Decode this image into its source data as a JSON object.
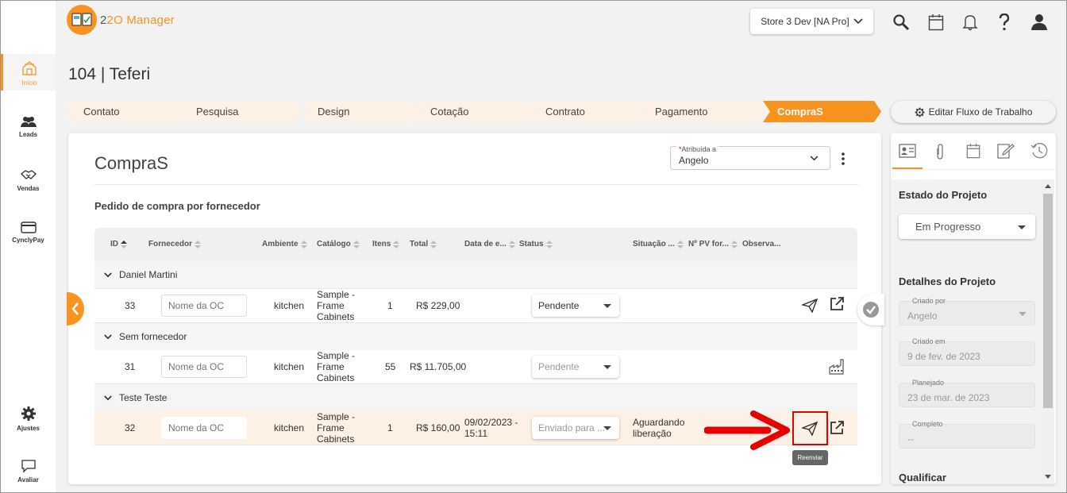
{
  "app": {
    "name_prefix": "2",
    "name_o": "O",
    "name_rest": "2O Manager",
    "brand_color": "#f7931e"
  },
  "nav": {
    "items": [
      {
        "label": "Início",
        "icon": "home-icon"
      },
      {
        "label": "Leads",
        "icon": "users-icon"
      },
      {
        "label": "Vendas",
        "icon": "handshake-icon"
      },
      {
        "label": "CynclyPay",
        "icon": "card-icon"
      },
      {
        "label": "Ajustes",
        "icon": "gear-icon"
      },
      {
        "label": "Avaliar",
        "icon": "chat-icon"
      }
    ]
  },
  "header": {
    "store": "Store 3 Dev [NA Pro]"
  },
  "page": {
    "title": "104 | Teferi"
  },
  "workflow": {
    "steps": [
      "Contato",
      "Pesquisa",
      "Design",
      "Cotação",
      "Contrato",
      "Pagamento",
      "CompraS"
    ],
    "active": "CompraS",
    "edit_label": "Editar Fluxo de Trabalho"
  },
  "main": {
    "title": "CompraS",
    "assigned_label": "Atribuída a",
    "assigned_value": "Angelo",
    "subtitle": "Pedido de compra por fornecedor",
    "columns": [
      "ID",
      "Fornecedor",
      "Ambiente",
      "Catálogo",
      "Itens",
      "Total",
      "Data de e...",
      "Status",
      "Situação ...",
      "Nº PV for...",
      "Observa..."
    ],
    "groups": [
      {
        "name": "Daniel Martini",
        "row": {
          "id": "33",
          "oc_placeholder": "Nome da OC",
          "ambiente": "kitchen",
          "catalog": [
            "Sample -",
            "Frame",
            "Cabinets"
          ],
          "itens": "1",
          "total": "R$ 229,00",
          "data_line1": "",
          "data_line2": "",
          "status": "Pendente",
          "situacao_line1": "",
          "situacao_line2": ""
        }
      },
      {
        "name": "Sem fornecedor",
        "row": {
          "id": "31",
          "oc_placeholder": "Nome da OC",
          "ambiente": "kitchen",
          "catalog": [
            "Sample -",
            "Frame",
            "Cabinets"
          ],
          "itens": "55",
          "total": "R$ 11.705,00",
          "data_line1": "",
          "data_line2": "",
          "status": "Pendente",
          "situacao_line1": "",
          "situacao_line2": ""
        }
      },
      {
        "name": "Teste Teste",
        "row": {
          "id": "32",
          "oc_placeholder": "Nome da OC",
          "ambiente": "kitchen",
          "catalog": [
            "Sample -",
            "Frame",
            "Cabinets"
          ],
          "itens": "1",
          "total": "R$ 160,00",
          "data_line1": "09/02/2023 -",
          "data_line2": "15:11",
          "status": "Enviado para ...",
          "situacao_line1": "Aguardando",
          "situacao_line2": "liberação"
        }
      }
    ],
    "tooltip": "Reenviar"
  },
  "right_panel": {
    "tabs": [
      "contact-card-icon",
      "paperclip-icon",
      "calendar-icon",
      "notes-icon",
      "history-icon"
    ],
    "estado_title": "Estado do Projeto",
    "estado_value": "Em Progresso",
    "detalhes_title": "Detalhes do Projeto",
    "criado_por_label": "Criado por",
    "criado_por_value": "Angelo",
    "criado_em_label": "Criado em",
    "criado_em_value": "9 de fev. de 2023",
    "planejado_label": "Planejado",
    "planejado_value": "23 de mar. de 2023",
    "completo_label": "Completo",
    "completo_value": "--",
    "qualificar_title": "Qualificar"
  }
}
